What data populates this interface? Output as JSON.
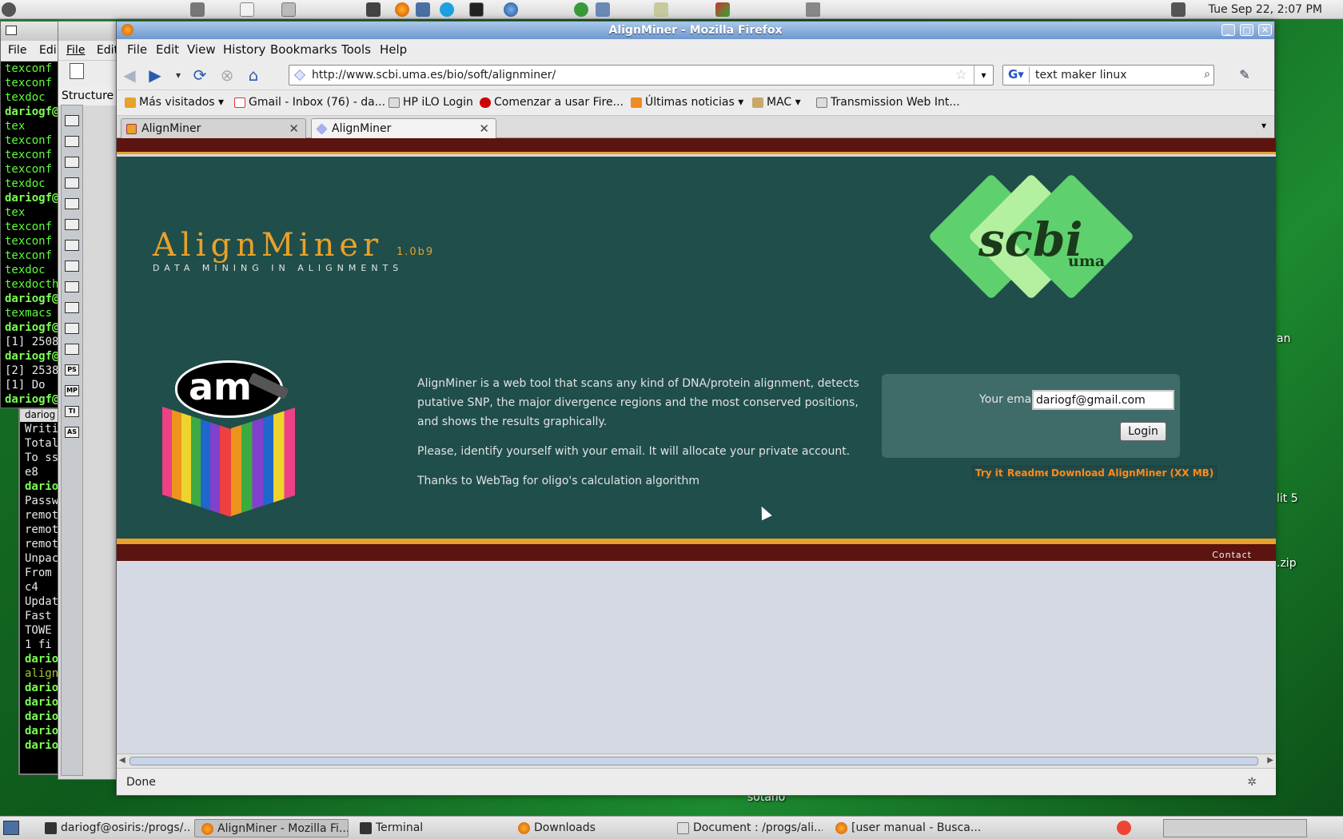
{
  "top_panel": {
    "clock": "Tue Sep 22,  2:07 PM",
    "icons": [
      "gnome-foot-icon",
      "people-icon",
      "text-editor-icon",
      "printer-icon",
      "calculator-icon",
      "firefox-icon",
      "computer-icon",
      "skype-icon",
      "terminal-icon",
      "thunderbird-icon",
      "network-icon",
      "monitor-icon",
      "image-viewer-icon",
      "app-icon",
      "volume-icon",
      "screenshot-icon"
    ]
  },
  "background": {
    "terminal1_menu": [
      "File",
      "Edi"
    ],
    "terminal1_lines": [
      {
        "t": "texconf",
        "c": "g"
      },
      {
        "t": "texconf",
        "c": "g"
      },
      {
        "t": "texdoc",
        "c": "g"
      },
      {
        "t": "dariogf@",
        "c": "gb"
      },
      {
        "t": "tex",
        "c": "g"
      },
      {
        "t": "texconf",
        "c": "g"
      },
      {
        "t": "texconf",
        "c": "g"
      },
      {
        "t": "texconf",
        "c": "g"
      },
      {
        "t": "texdoc",
        "c": "g"
      },
      {
        "t": "dariogf@",
        "c": "gb"
      },
      {
        "t": "tex",
        "c": "g"
      },
      {
        "t": "texconf",
        "c": "g"
      },
      {
        "t": "texconf",
        "c": "g"
      },
      {
        "t": "texconf",
        "c": "g"
      },
      {
        "t": "texdoc",
        "c": "g"
      },
      {
        "t": "texdocth",
        "c": "g"
      },
      {
        "t": "dariogf@",
        "c": "gb"
      },
      {
        "t": "texmacs",
        "c": "g"
      },
      {
        "t": "dariogf@",
        "c": "gb"
      },
      {
        "t": "[1] 2508",
        "c": "w"
      },
      {
        "t": "dariogf@",
        "c": "gb"
      },
      {
        "t": "[2] 2538",
        "c": "w"
      },
      {
        "t": "[1]   Do",
        "c": "w"
      },
      {
        "t": "dariogf@",
        "c": "gb"
      }
    ],
    "terminal2_title": "dariog",
    "terminal2_lines": [
      {
        "t": "Writi",
        "c": "w"
      },
      {
        "t": "Total",
        "c": "w"
      },
      {
        "t": "To ss",
        "c": "w"
      },
      {
        "t": "  e8",
        "c": "w"
      },
      {
        "t": "dario",
        "c": "gb"
      },
      {
        "t": "Passw",
        "c": "w"
      },
      {
        "t": "remot",
        "c": "w"
      },
      {
        "t": "remot",
        "c": "w"
      },
      {
        "t": "remot",
        "c": "w"
      },
      {
        "t": "Unpac",
        "c": "w"
      },
      {
        "t": "From ",
        "c": "w"
      },
      {
        "t": "  c4",
        "c": "w"
      },
      {
        "t": "Updat",
        "c": "w"
      },
      {
        "t": "Fast ",
        "c": "w"
      },
      {
        "t": " TOWE",
        "c": "w"
      },
      {
        "t": " 1 fi",
        "c": "w"
      },
      {
        "t": "dario",
        "c": "gb"
      },
      {
        "t": "align",
        "c": "y"
      },
      {
        "t": "dario",
        "c": "gb"
      },
      {
        "t": "dario",
        "c": "gb"
      },
      {
        "t": "dario",
        "c": "gb"
      },
      {
        "t": "dario",
        "c": "gb"
      },
      {
        "t": "dario",
        "c": "gb"
      }
    ],
    "editor_menu": [
      "File",
      "Edit"
    ],
    "editor_structure": "Structure",
    "editor_tool_labels": [
      "",
      "",
      "",
      "",
      "",
      "",
      "",
      "",
      "",
      "",
      "",
      "",
      "PS",
      "MP",
      "TI",
      "AS"
    ],
    "desktop_labels": [
      {
        "text": "an"
      },
      {
        "text": "lit 5"
      },
      {
        "text": ".zip"
      },
      {
        "text": "sotano"
      }
    ]
  },
  "firefox": {
    "title": "AlignMiner - Mozilla Firefox",
    "menu": [
      "File",
      "Edit",
      "View",
      "History",
      "Bookmarks",
      "Tools",
      "Help"
    ],
    "url": "http://www.scbi.uma.es/bio/soft/alignminer/",
    "search": "text maker linux",
    "bookmarks": [
      "Más visitados",
      "Gmail - Inbox (76) - da...",
      "HP iLO Login",
      "Comenzar a usar Fire...",
      "Últimas noticias",
      "MAC",
      "Transmission Web Int..."
    ],
    "tabs": [
      "AlignMiner",
      "AlignMiner"
    ],
    "status": "Done"
  },
  "page": {
    "title": "AlignMiner",
    "version": "1.0b9",
    "tagline": "DATA MINING IN ALIGNMENTS",
    "scbi_logo": "scbi",
    "scbi_sub": "uma",
    "am_logo": "am",
    "desc": [
      "AlignMiner is a web tool that scans any kind of DNA/protein alignment, detects putative SNP, the major divergence regions and the most conserved positions, and shows the results graphically.",
      "Please, identify yourself with your email. It will allocate your private account.",
      "Thanks to WebTag for oligo's calculation algorithm"
    ],
    "email_label": "Your email:",
    "email_value": "dariogf@gmail.com",
    "login": "Login",
    "links": [
      "Try it!",
      "Readme",
      "Download AlignMiner (XX MB)"
    ],
    "contact": "Contact",
    "colors": {
      "main_bg": "#1f4e4b",
      "band": "#5c1410",
      "accent": "#e8a12a",
      "link": "#ff8a1a"
    }
  },
  "taskbar": {
    "tasks": [
      "dariogf@osiris:/progs/...",
      "AlignMiner - Mozilla Fi...",
      "Terminal",
      "Downloads",
      "Document : /progs/ali...",
      "[user manual - Busca..."
    ]
  }
}
